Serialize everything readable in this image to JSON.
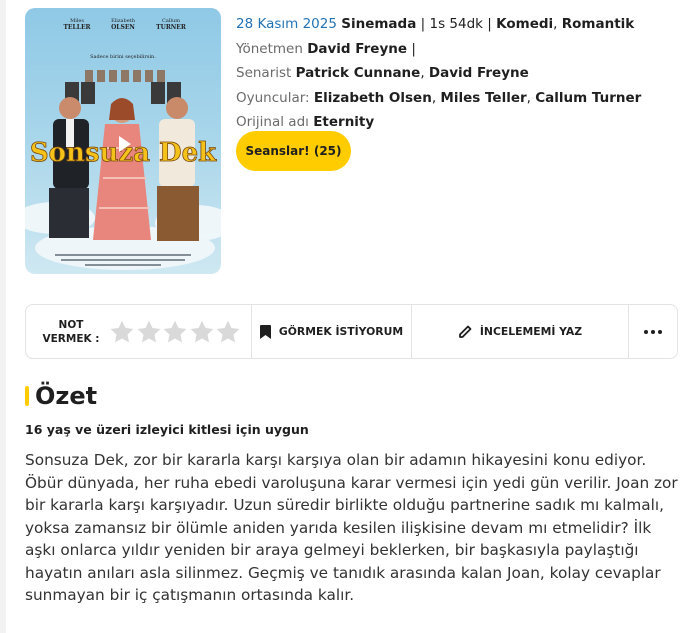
{
  "movie": {
    "release_date": "28 Kasım 2025",
    "status": "Sinemada",
    "duration": "1s 54dk",
    "genres": [
      "Komedi",
      "Romantik"
    ],
    "director_label": "Yönetmen",
    "director": "David Freyne",
    "writers_label": "Senarist",
    "writers": [
      "Patrick Cunnane",
      "David Freyne"
    ],
    "cast_label": "Oyuncular:",
    "cast": [
      "Elizabeth Olsen",
      "Miles Teller",
      "Callum Turner"
    ],
    "original_title_label": "Orijinal adı",
    "original_title": "Eternity"
  },
  "poster": {
    "title_text": "Sonsuza Dek",
    "actors": [
      "Miles TELLER",
      "Elizabeth OLSEN",
      "Callum TURNER"
    ],
    "tagline": "Sadece birini seçebilirsin.",
    "play_icon": "play-icon"
  },
  "sessions_button": "Seanslar! (25)",
  "actions": {
    "rate_label_1": "NOT",
    "rate_label_2": "VERMEK :",
    "star_count": 5,
    "watchlist": "GÖRMEK İSTİYORUM",
    "review": "İNCELEMEMİ YAZ",
    "icons": [
      "star-icon",
      "bookmark-icon",
      "pencil-icon",
      "more-dots-icon"
    ]
  },
  "summary": {
    "heading": "Özet",
    "age_note": "16 yaş ve üzeri izleyici kitlesi için uygun",
    "text": "Sonsuza Dek, zor bir kararla karşı karşıya olan bir adamın hikayesini konu ediyor. Öbür dünyada, her ruha ebedi varoluşuna karar vermesi için yedi gün verilir. Joan zor bir kararla karşı karşıyadır. Uzun süredir birlikte olduğu partnerine sadık mı kalmalı, yoksa zamansız bir ölümle aniden yarıda kesilen ilişkisine devam mı etmelidir? İlk aşkı onlarca yıldır yeniden bir araya gelmeyi beklerken, bir başkasıyla paylaştığı hayatın anıları asla silinmez. Geçmiş ve tanıdık arasında kalan Joan, kolay cevaplar sunmayan bir iç çatışmanın ortasında kalır."
  },
  "colors": {
    "accent": "#ffcc00",
    "link_blue": "#2573b5",
    "star_empty": "#d9d9d9"
  }
}
